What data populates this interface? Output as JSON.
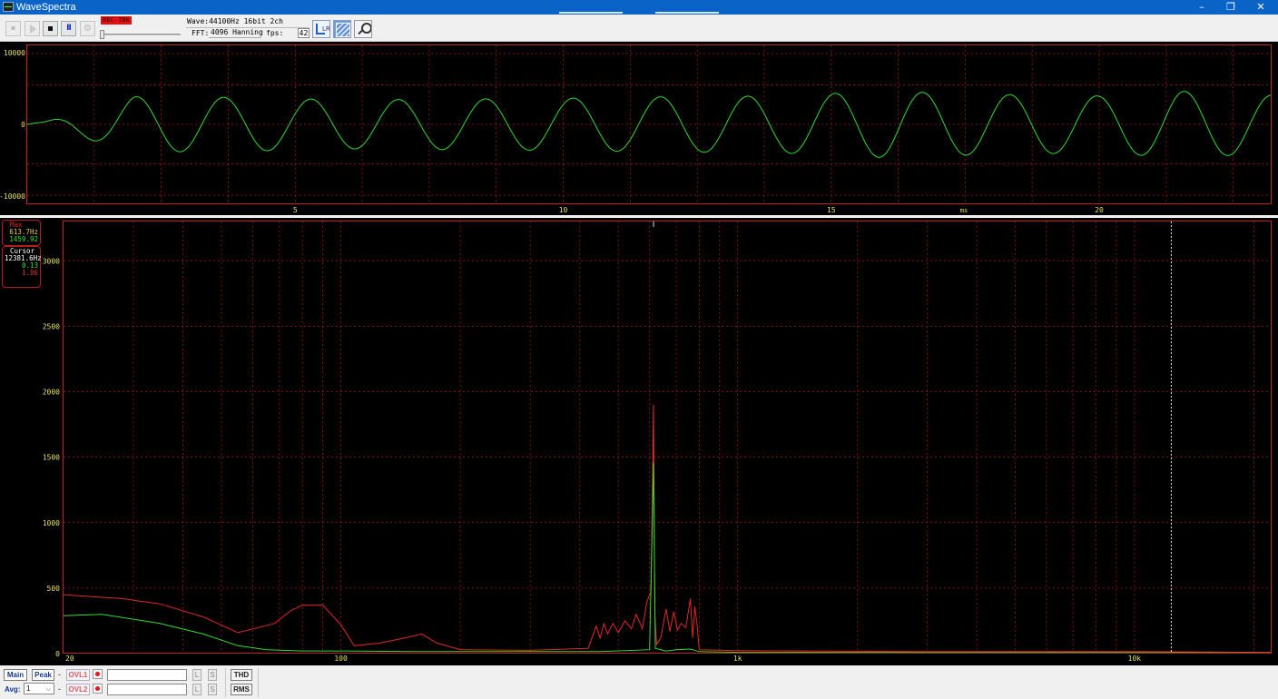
{
  "window": {
    "title": "WaveSpectra",
    "minimize": "–",
    "restore": "❐",
    "close": "✕"
  },
  "toolbar": {
    "rec_tag": "REC T0k",
    "pause_label": "II",
    "wave_info": "Wave:44100Hz 16bit 2ch",
    "fft_label": "FFT:",
    "fft_value": "4096 Hanning",
    "fps_label": "fps:",
    "fps_value": "42",
    "lr_icon": "LR"
  },
  "icons": [
    "record-icon",
    "play-icon",
    "stop-icon",
    "pause-icon",
    "settings-icon",
    "lr-channel-icon",
    "graph-settings-icon",
    "zoom-icon"
  ],
  "chart_data": [
    {
      "type": "line",
      "title": "",
      "xlabel": "ms",
      "ylabel": "",
      "xlim": [
        0,
        23.2
      ],
      "ylim": [
        -10000,
        10000
      ],
      "x_ticks": [
        "5",
        "10",
        "15",
        "20"
      ],
      "y_ticks": [
        "10000",
        "0",
        "-10000"
      ],
      "grid": true,
      "series": [
        {
          "color": "#2fdc2f",
          "frequency_hz": 613.7,
          "amplitude_points": [
            [
              0.0,
              -300
            ],
            [
              2.0,
              3500
            ],
            [
              4.0,
              3400
            ],
            [
              6.0,
              3100
            ],
            [
              8.0,
              3200
            ],
            [
              10.0,
              3300
            ],
            [
              12.0,
              3500
            ],
            [
              14.0,
              3600
            ],
            [
              16.0,
              4200
            ],
            [
              18.0,
              3800
            ],
            [
              20.0,
              3600
            ],
            [
              21.5,
              4200
            ],
            [
              23.2,
              3700
            ]
          ]
        }
      ]
    },
    {
      "type": "line",
      "title": "",
      "xlabel": "",
      "ylabel": "",
      "x_scale": "log",
      "xlim": [
        20,
        22050
      ],
      "ylim": [
        0,
        3300
      ],
      "x_ticks": [
        "20",
        "100",
        "1k",
        "10k"
      ],
      "y_ticks": [
        "3000",
        "2500",
        "2000",
        "1500",
        "1000",
        "500",
        "0"
      ],
      "grid": true,
      "cursor_freq": 12381.6,
      "series": [
        {
          "color": "#e02828",
          "points": [
            [
              20,
              450
            ],
            [
              28,
              420
            ],
            [
              35,
              380
            ],
            [
              45,
              280
            ],
            [
              55,
              160
            ],
            [
              68,
              230
            ],
            [
              75,
              330
            ],
            [
              80,
              370
            ],
            [
              90,
              370
            ],
            [
              100,
              220
            ],
            [
              108,
              60
            ],
            [
              125,
              80
            ],
            [
              145,
              120
            ],
            [
              160,
              150
            ],
            [
              175,
              80
            ],
            [
              200,
              30
            ],
            [
              300,
              25
            ],
            [
              420,
              40
            ],
            [
              440,
              210
            ],
            [
              450,
              120
            ],
            [
              460,
              230
            ],
            [
              470,
              150
            ],
            [
              485,
              230
            ],
            [
              500,
              160
            ],
            [
              520,
              250
            ],
            [
              540,
              190
            ],
            [
              555,
              300
            ],
            [
              575,
              190
            ],
            [
              590,
              390
            ],
            [
              605,
              480
            ],
            [
              613.7,
              1900
            ],
            [
              618,
              320
            ],
            [
              625,
              70
            ],
            [
              640,
              120
            ],
            [
              660,
              340
            ],
            [
              675,
              170
            ],
            [
              690,
              320
            ],
            [
              705,
              180
            ],
            [
              720,
              230
            ],
            [
              740,
              200
            ],
            [
              760,
              420
            ],
            [
              770,
              120
            ],
            [
              780,
              360
            ],
            [
              790,
              220
            ],
            [
              800,
              30
            ],
            [
              1000,
              22
            ],
            [
              3000,
              15
            ],
            [
              10000,
              15
            ],
            [
              22050,
              10
            ]
          ]
        },
        {
          "color": "#2fdc2f",
          "points": [
            [
              20,
              290
            ],
            [
              25,
              300
            ],
            [
              35,
              230
            ],
            [
              45,
              150
            ],
            [
              55,
              60
            ],
            [
              65,
              30
            ],
            [
              80,
              20
            ],
            [
              100,
              20
            ],
            [
              150,
              15
            ],
            [
              300,
              15
            ],
            [
              450,
              15
            ],
            [
              600,
              30
            ],
            [
              613.7,
              1460
            ],
            [
              620,
              40
            ],
            [
              660,
              20
            ],
            [
              700,
              30
            ],
            [
              760,
              35
            ],
            [
              800,
              15
            ],
            [
              1000,
              10
            ],
            [
              10000,
              8
            ],
            [
              22050,
              5
            ]
          ]
        }
      ]
    }
  ],
  "readout_max": {
    "title": "Max",
    "freq": "613.7Hz",
    "green": "1459.92"
  },
  "readout_cursor": {
    "title": "Cursor",
    "freq": "12381.6Hz",
    "green": "0.13",
    "red": "1.86"
  },
  "status": {
    "main": "Main",
    "peak": "Peak",
    "dash": "-",
    "ovl1": "OVL1",
    "ovl2": "OVL2",
    "l": "L",
    "s": "S",
    "thd": "THD",
    "rms": "RMS",
    "avg_label": "Avg:",
    "avg_value": "1"
  }
}
